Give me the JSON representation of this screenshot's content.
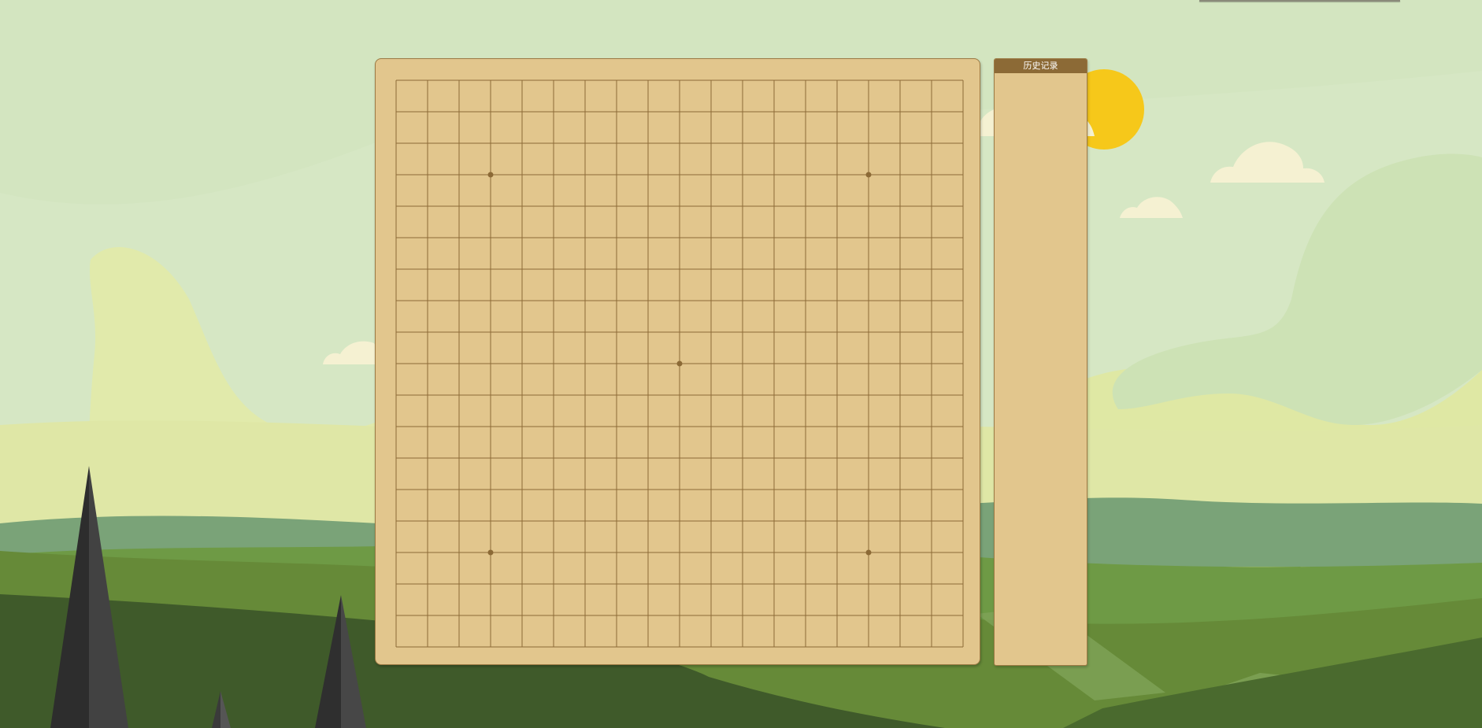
{
  "board": {
    "size": 19,
    "star_points": [
      [
        3,
        3
      ],
      [
        15,
        3
      ],
      [
        9,
        9
      ],
      [
        3,
        15
      ],
      [
        15,
        15
      ]
    ],
    "colors": {
      "wood": "#e2c68d",
      "grid_line": "#8c6a36",
      "star_point": "#8c6a36"
    }
  },
  "history": {
    "title": "历史记录",
    "moves": []
  },
  "background": {
    "sky": "#d6e6c4",
    "hill_light": "#e0e8a8",
    "grass_mid": "#668a38",
    "grass_dark": "#3f5a2a",
    "sun": "#f6c81a",
    "cloud": "#f5f1d2",
    "tree": "#2e2e2e"
  }
}
